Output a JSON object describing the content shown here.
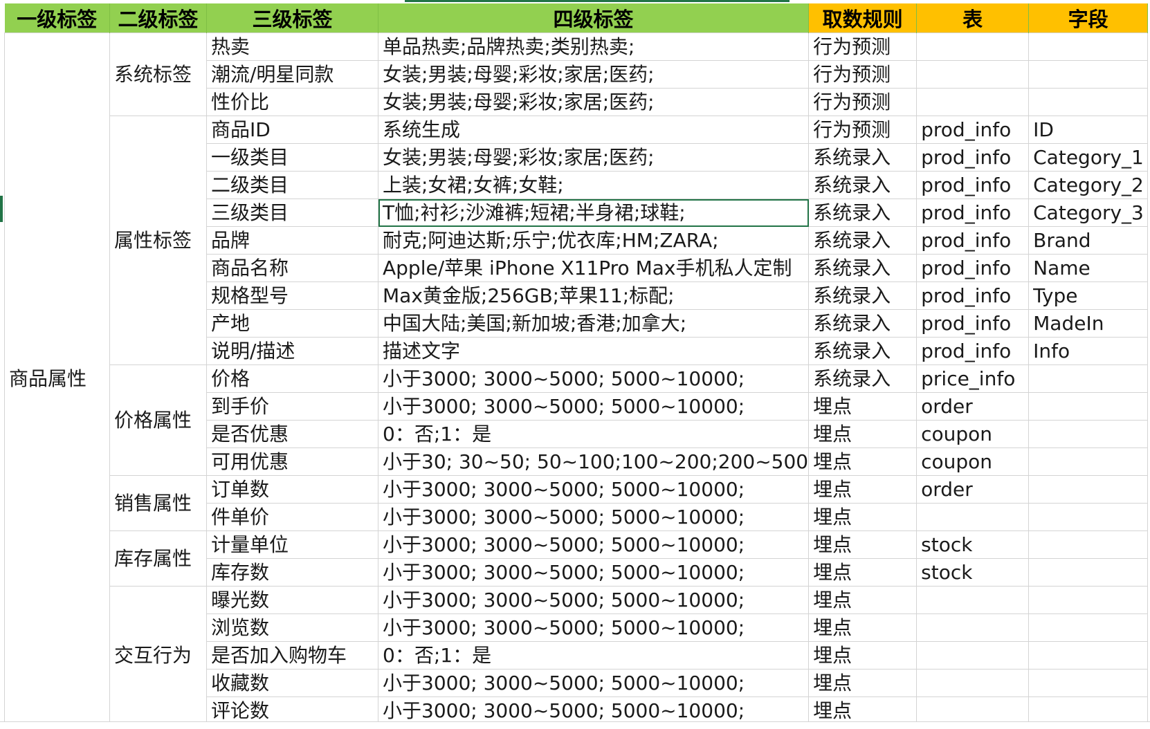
{
  "headers": [
    "一级标签",
    "二级标签",
    "三级标签",
    "四级标签",
    "取数规则",
    "表",
    "字段"
  ],
  "level1": "商品属性",
  "groups": [
    {
      "level2": "系统标签",
      "rows": [
        {
          "l3": "热卖",
          "l4": "单品热卖;品牌热卖;类别热卖;",
          "rule": "行为预测",
          "table": "",
          "field": ""
        },
        {
          "l3": "潮流/明星同款",
          "l4": "女装;男装;母婴;彩妆;家居;医药;",
          "rule": "行为预测",
          "table": "",
          "field": ""
        },
        {
          "l3": "性价比",
          "l4": "女装;男装;母婴;彩妆;家居;医药;",
          "rule": "行为预测",
          "table": "",
          "field": ""
        }
      ]
    },
    {
      "level2": "属性标签",
      "rows": [
        {
          "l3": "商品ID",
          "l4": "系统生成",
          "rule": "行为预测",
          "table": "prod_info",
          "field": "ID"
        },
        {
          "l3": "一级类目",
          "l4": "女装;男装;母婴;彩妆;家居;医药;",
          "rule": "系统录入",
          "table": "prod_info",
          "field": "Category_1"
        },
        {
          "l3": "二级类目",
          "l4": "上装;女裙;女裤;女鞋;",
          "rule": "系统录入",
          "table": "prod_info",
          "field": "Category_2"
        },
        {
          "l3": "三级类目",
          "l4": "T恤;衬衫;沙滩裤;短裙;半身裙;球鞋;",
          "rule": "系统录入",
          "table": "prod_info",
          "field": "Category_3"
        },
        {
          "l3": "品牌",
          "l4": "耐克;阿迪达斯;乐宁;优衣库;HM;ZARA;",
          "rule": "系统录入",
          "table": "prod_info",
          "field": "Brand"
        },
        {
          "l3": "商品名称",
          "l4": "Apple/苹果 iPhone X11Pro Max手机私人定制",
          "rule": "系统录入",
          "table": "prod_info",
          "field": "Name"
        },
        {
          "l3": "规格型号",
          "l4": "Max黄金版;256GB;苹果11;标配;",
          "rule": "系统录入",
          "table": "prod_info",
          "field": "Type"
        },
        {
          "l3": "产地",
          "l4": "中国大陆;美国;新加坡;香港;加拿大;",
          "rule": "系统录入",
          "table": "prod_info",
          "field": "MadeIn"
        },
        {
          "l3": "说明/描述",
          "l4": "描述文字",
          "rule": "系统录入",
          "table": "prod_info",
          "field": "Info"
        }
      ]
    },
    {
      "level2": "价格属性",
      "rows": [
        {
          "l3": "价格",
          "l4": "小于3000; 3000~5000; 5000~10000;",
          "rule": "系统录入",
          "table": "price_info",
          "field": ""
        },
        {
          "l3": "到手价",
          "l4": "小于3000; 3000~5000; 5000~10000;",
          "rule": "埋点",
          "table": "order",
          "field": ""
        },
        {
          "l3": "是否优惠",
          "l4": "0：否;1：是",
          "rule": "埋点",
          "table": "coupon",
          "field": ""
        },
        {
          "l3": "可用优惠",
          "l4": "小于30; 30~50; 50~100;100~200;200~500",
          "rule": "埋点",
          "table": "coupon",
          "field": ""
        }
      ]
    },
    {
      "level2": "销售属性",
      "rows": [
        {
          "l3": "订单数",
          "l4": "小于3000; 3000~5000; 5000~10000;",
          "rule": "埋点",
          "table": "order",
          "field": ""
        },
        {
          "l3": "件单价",
          "l4": "小于3000; 3000~5000; 5000~10000;",
          "rule": "埋点",
          "table": "",
          "field": ""
        }
      ]
    },
    {
      "level2": "库存属性",
      "rows": [
        {
          "l3": "计量单位",
          "l4": "小于3000; 3000~5000; 5000~10000;",
          "rule": "埋点",
          "table": "stock",
          "field": ""
        },
        {
          "l3": "库存数",
          "l4": "小于3000; 3000~5000; 5000~10000;",
          "rule": "埋点",
          "table": "stock",
          "field": ""
        }
      ]
    },
    {
      "level2": "交互行为",
      "rows": [
        {
          "l3": "曝光数",
          "l4": "小于3000; 3000~5000; 5000~10000;",
          "rule": "埋点",
          "table": "",
          "field": ""
        },
        {
          "l3": "浏览数",
          "l4": "小于3000; 3000~5000; 5000~10000;",
          "rule": "埋点",
          "table": "",
          "field": ""
        },
        {
          "l3": "是否加入购物车",
          "l4": "0：否;1：是",
          "rule": "埋点",
          "table": "",
          "field": ""
        },
        {
          "l3": "收藏数",
          "l4": "小于3000; 3000~5000; 5000~10000;",
          "rule": "埋点",
          "table": "",
          "field": ""
        },
        {
          "l3": "评论数",
          "l4": "小于3000; 3000~5000; 5000~10000;",
          "rule": "埋点",
          "table": "",
          "field": ""
        }
      ]
    }
  ],
  "colors": {
    "header_green": "#92d050",
    "header_orange": "#ffc000",
    "selection": "#217346",
    "gridline": "#d4d4d4"
  },
  "selected_cell": {
    "group": 1,
    "row": 3,
    "column": "l4"
  }
}
